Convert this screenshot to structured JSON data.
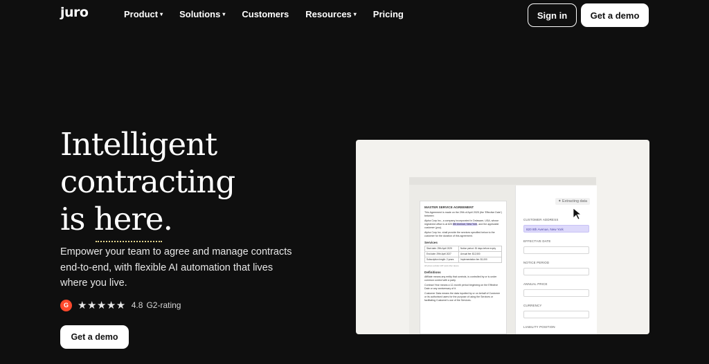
{
  "brand": {
    "logo": "juro"
  },
  "nav": {
    "items": [
      {
        "label": "Product",
        "caret": true
      },
      {
        "label": "Solutions",
        "caret": true
      },
      {
        "label": "Customers",
        "caret": false
      },
      {
        "label": "Resources",
        "caret": true
      },
      {
        "label": "Pricing",
        "caret": false
      }
    ],
    "signin_label": "Sign in",
    "demo_label": "Get a demo",
    "caret_glyph": "▾"
  },
  "hero": {
    "title_line1": "Intelligent",
    "title_line2": "contracting",
    "title_line3_pre": "is ",
    "title_line3_word": "here",
    "title_line3_post": ".",
    "subtitle": "Empower your team to agree and manage contracts end-to-end, with flexible AI automation that lives where you live.",
    "rating": {
      "badge": "G",
      "stars": "★★★★★",
      "score": "4.8",
      "label": "G2-rating"
    },
    "cta_label": "Get a demo"
  },
  "mock": {
    "doc": {
      "title": "MASTER SERVICE AGREEMENT",
      "intro": "This Agreement is made on the 29th of April 2025 (the 'Effective Date') between",
      "party1_pre": "Alpha Corp Inc., a company incorporated in Delaware, USA, whose registered office is at 820 ",
      "party1_hl": "8th Avenue, New York",
      "party1_post": ", and the applicable customer (you).",
      "party2": "Alpha Corp Inc. shall provide the services specified below to the customer for the duration of this agreement.",
      "services_heading": "Services",
      "table": [
        [
          "Start date: 29th April 2025",
          "Notice period: 30 days before expiry"
        ],
        [
          "End date: 29th April 2027",
          "Annual fee: $12,500"
        ],
        [
          "Subscription length: 2 years",
          "Implementation fee: $1,000"
        ]
      ],
      "table_note": "All prices exclude VAT (and other taxes).",
      "definitions_heading": "Definitions",
      "def1": "Affiliate means any entity that controls, is controlled by or is under common control with a party.",
      "def2": "Contract Year means a 12-month period beginning on the Effective Date or any anniversary of it.",
      "def3": "Customer Data means the data inputted by or on behalf of Customer or its authorised users for the purpose of using the Services or facilitating Customer's use of the Services."
    },
    "panel": {
      "status": "✦ Extracting data",
      "fields": [
        {
          "label": "CUSTOMER ADDRESS",
          "value": "820 8th Avenue, New York"
        },
        {
          "label": "EFFECTIVE DATE",
          "value": ""
        },
        {
          "label": "NOTICE PERIOD",
          "value": ""
        },
        {
          "label": "ANNUAL PRICE",
          "value": ""
        },
        {
          "label": "CURRENCY",
          "value": ""
        },
        {
          "label": "LIABILITY POSITION",
          "value": ""
        }
      ]
    }
  }
}
